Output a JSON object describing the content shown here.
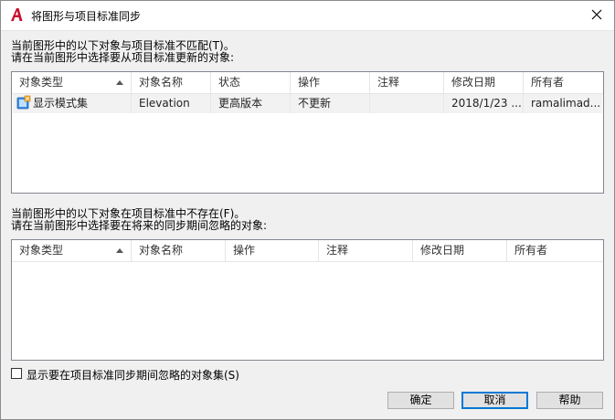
{
  "window": {
    "title": "将图形与项目标准同步",
    "app_icon": "autocad-a-icon",
    "close_glyph": "✕"
  },
  "section1": {
    "line1": "当前图形中的以下对象与项目标准不匹配(T)。",
    "line2": "请在当前图形中选择要从项目标准更新的对象:"
  },
  "table1": {
    "columns": [
      "对象类型",
      "对象名称",
      "状态",
      "操作",
      "注释",
      "修改日期",
      "所有者"
    ],
    "rows": [
      {
        "type": "显示模式集",
        "name": "Elevation",
        "status": "更高版本",
        "action": "不更新",
        "note": "",
        "modified": "2018/1/23 ...",
        "owner": "ramalimad..."
      }
    ]
  },
  "section2": {
    "line1": "当前图形中的以下对象在项目标准中不存在(F)。",
    "line2": "请在当前图形中选择要在将来的同步期间忽略的对象:"
  },
  "table2": {
    "columns": [
      "对象类型",
      "对象名称",
      "操作",
      "注释",
      "修改日期",
      "所有者"
    ]
  },
  "checkbox": {
    "label": "显示要在项目标准同步期间忽略的对象集(S)",
    "checked": false
  },
  "buttons": {
    "ok": "确定",
    "cancel": "取消",
    "help": "帮助"
  },
  "colors": {
    "accent": "#0078d7",
    "app_icon_red": "#c8102e"
  }
}
